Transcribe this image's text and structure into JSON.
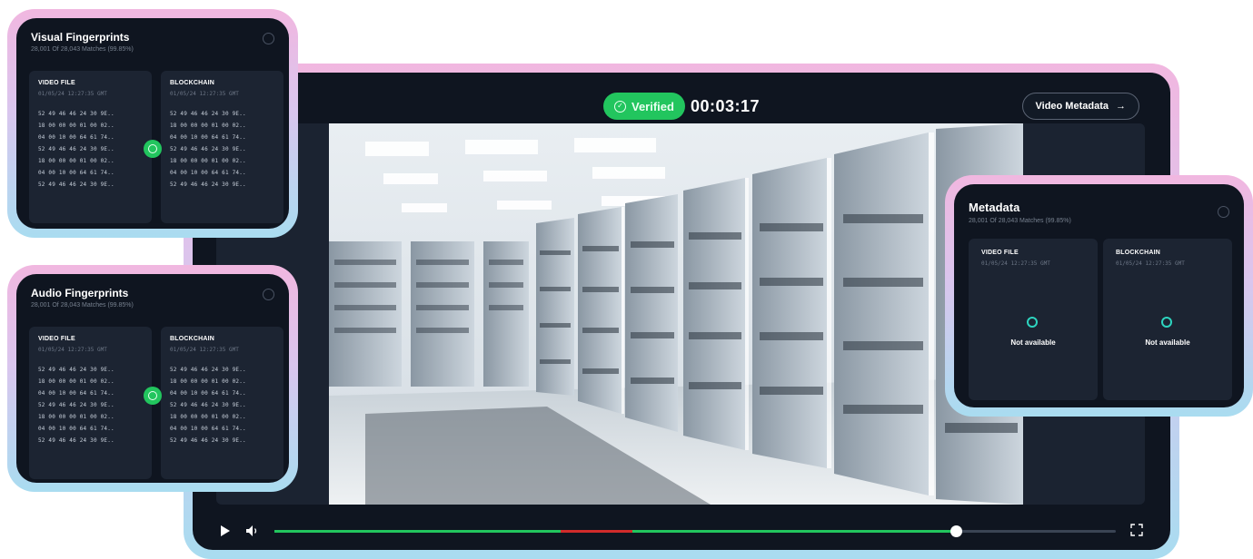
{
  "player": {
    "verified_label": "Verified",
    "timecode": "00:03:17",
    "metadata_button": "Video Metadata",
    "progress": {
      "green_end": 0.34,
      "red_start": 0.34,
      "red_end": 0.425,
      "played": 0.81
    },
    "colors": {
      "accent": "#22c55e",
      "marker": "#d12b2b"
    }
  },
  "visual_card": {
    "title": "Visual Fingerprints",
    "subtitle": "28,001 Of 28,043 Matches (99.85%)",
    "left": {
      "header": "VIDEO FILE",
      "date": "01/05/24 12:27:35 GMT",
      "rows": [
        "52 49 46 46 24 30 9E..",
        "18 00 00 00 01 00 02..",
        "04 00 10 00 64 61 74..",
        "52 49 46 46 24 30 9E..",
        "18 00 00 00 01 00 02..",
        "04 00 10 00 64 61 74..",
        "52 49 46 46 24 30 9E.."
      ]
    },
    "right": {
      "header": "BLOCKCHAIN",
      "date": "01/05/24 12:27:35 GMT",
      "rows": [
        "52 49 46 46 24 30 9E..",
        "18 00 00 00 01 00 02..",
        "04 00 10 00 64 61 74..",
        "52 49 46 46 24 30 9E..",
        "18 00 00 00 01 00 02..",
        "04 00 10 00 64 61 74..",
        "52 49 46 46 24 30 9E.."
      ]
    }
  },
  "audio_card": {
    "title": "Audio Fingerprints",
    "subtitle": "28,001 Of 28,043 Matches (99.85%)",
    "left": {
      "header": "VIDEO FILE",
      "date": "01/05/24 12:27:35 GMT",
      "rows": [
        "52 49 46 46 24 30 9E..",
        "18 00 00 00 01 00 02..",
        "04 00 10 00 64 61 74..",
        "52 49 46 46 24 30 9E..",
        "18 00 00 00 01 00 02..",
        "04 00 10 00 64 61 74..",
        "52 49 46 46 24 30 9E.."
      ]
    },
    "right": {
      "header": "BLOCKCHAIN",
      "date": "01/05/24 12:27:35 GMT",
      "rows": [
        "52 49 46 46 24 30 9E..",
        "18 00 00 00 01 00 02..",
        "04 00 10 00 64 61 74..",
        "52 49 46 46 24 30 9E..",
        "18 00 00 00 01 00 02..",
        "04 00 10 00 64 61 74..",
        "52 49 46 46 24 30 9E.."
      ]
    }
  },
  "metadata_card": {
    "title": "Metadata",
    "subtitle": "28,001 Of 28,043 Matches (99.85%)",
    "left": {
      "header": "VIDEO FILE",
      "date": "01/05/24 12:27:35 GMT",
      "status": "Not available"
    },
    "right": {
      "header": "BLOCKCHAIN",
      "date": "01/05/24 12:27:35 GMT",
      "status": "Not available"
    }
  }
}
